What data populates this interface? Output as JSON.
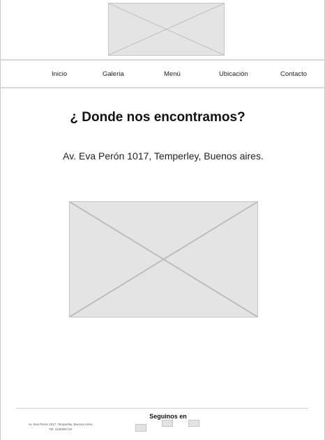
{
  "nav": {
    "items": [
      "Inicio",
      "Galeria",
      "Menú",
      "Ubicación",
      "Contacto"
    ]
  },
  "main": {
    "title": "¿ Donde nos encontramos?",
    "address": "Av. Eva Perón 1017, Temperley, Buenos aires."
  },
  "footer": {
    "follow_label": "Seguinos en",
    "address_line": "Av. Eva Perón 1017, Temperley, Buenos Aires.",
    "phone_line": "Tel: 1130261722"
  }
}
